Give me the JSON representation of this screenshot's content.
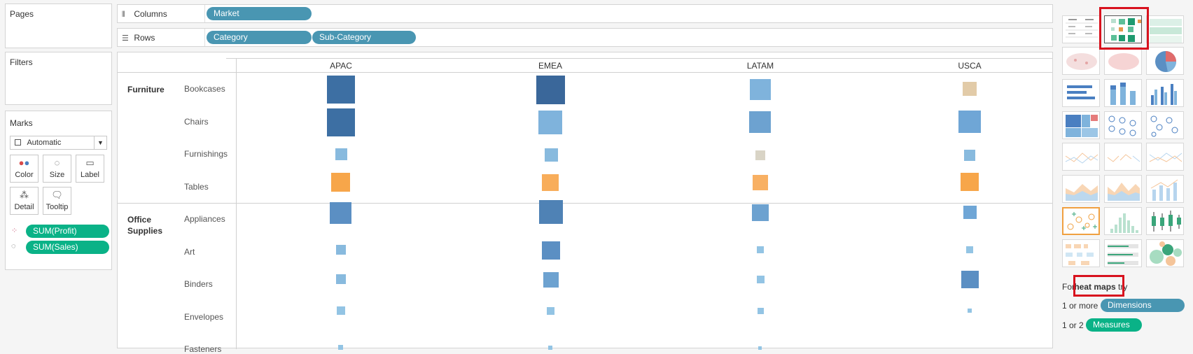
{
  "left": {
    "pages_title": "Pages",
    "filters_title": "Filters",
    "marks_title": "Marks",
    "mark_type": "Automatic",
    "cards": [
      "Color",
      "Size",
      "Label",
      "Detail",
      "Tooltip"
    ],
    "pills": [
      "SUM(Profit)",
      "SUM(Sales)"
    ]
  },
  "shelves": {
    "columns_label": "Columns",
    "rows_label": "Rows",
    "columns": [
      "Market"
    ],
    "rows": [
      "Category",
      "Sub-Category"
    ]
  },
  "view": {
    "markets": [
      "APAC",
      "EMEA",
      "LATAM",
      "USCA"
    ],
    "categories": [
      {
        "name": "Furniture",
        "subs": [
          "Bookcases",
          "Chairs",
          "Furnishings",
          "Tables"
        ]
      },
      {
        "name": "Office\nSupplies",
        "subs": [
          "Appliances",
          "Art",
          "Binders",
          "Envelopes",
          "Fasteners"
        ]
      }
    ]
  },
  "showme": {
    "hint_prefix": "For",
    "hint_type": "heat maps",
    "hint_suffix": "try",
    "dims_prefix": "1 or more",
    "dims_label": "Dimensions",
    "meas_prefix": "1 or 2",
    "meas_label": "Measures"
  },
  "colors": {
    "dark_blue": "#3d6fa3",
    "mid_blue": "#5b8fc3",
    "light_blue": "#7fb3dc",
    "pale_blue": "#93c4e4",
    "orange": "#f7a64a",
    "tan": "#e2cba8",
    "gray": "#d9d4c6",
    "highlight": "#d8121e"
  }
}
